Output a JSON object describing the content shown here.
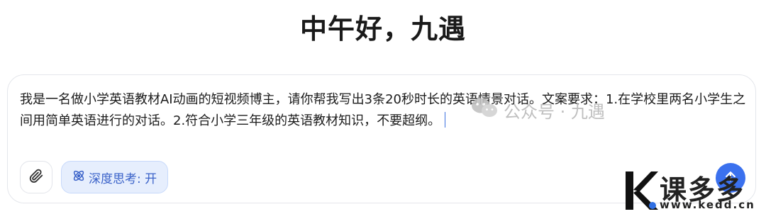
{
  "greeting": "中午好，九遇",
  "composer": {
    "prompt_text": "我是一名做小学英语教材AI动画的短视频博主，请你帮我写出3条20秒时长的英语情景对话。文案要求：1.在学校里两名小学生之间用简单英语进行的对话。2.符合小学三年级的英语教材知识，不要超纲。",
    "attach_icon": "paperclip-icon",
    "deep_think_label": "深度思考: 开",
    "deep_think_icon": "atom-icon",
    "send_icon": "arrow-up-icon",
    "accent_color": "#3b71ee"
  },
  "watermark": {
    "text": "公众号 · 九遇",
    "icon": "wechat-icon"
  },
  "brand": {
    "name": "课多多",
    "url": "www.kedd.cn",
    "logo": "K"
  }
}
